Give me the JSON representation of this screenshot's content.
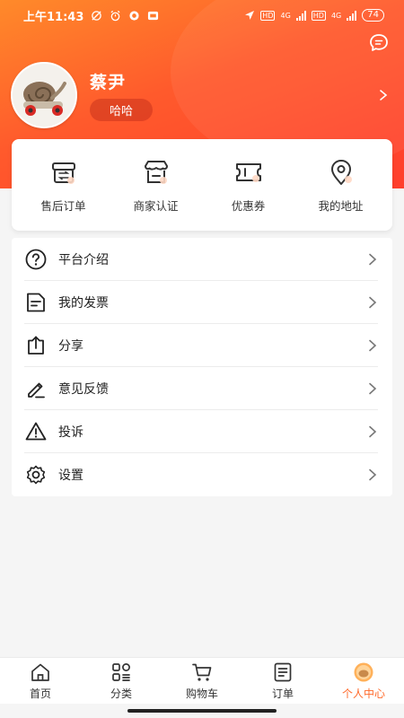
{
  "status": {
    "time": "上午11:43",
    "net_labels": [
      "HD",
      "4G",
      "HD",
      "4G"
    ],
    "battery": "74"
  },
  "profile": {
    "name": "蔡尹",
    "tag": "哈哈"
  },
  "quick_actions": [
    {
      "label": "售后订单",
      "icon": "return-box-icon"
    },
    {
      "label": "商家认证",
      "icon": "store-icon"
    },
    {
      "label": "优惠券",
      "icon": "coupon-icon"
    },
    {
      "label": "我的地址",
      "icon": "location-pin-icon"
    }
  ],
  "menu": [
    {
      "label": "平台介绍",
      "icon": "question-circle-icon"
    },
    {
      "label": "我的发票",
      "icon": "invoice-icon"
    },
    {
      "label": "分享",
      "icon": "share-icon"
    },
    {
      "label": "意见反馈",
      "icon": "pen-icon"
    },
    {
      "label": "投诉",
      "icon": "warning-icon"
    },
    {
      "label": "设置",
      "icon": "gear-icon"
    }
  ],
  "tabs": [
    {
      "label": "首页",
      "icon": "home-icon"
    },
    {
      "label": "分类",
      "icon": "category-icon"
    },
    {
      "label": "购物车",
      "icon": "cart-icon"
    },
    {
      "label": "订单",
      "icon": "order-list-icon"
    },
    {
      "label": "个人中心",
      "icon": "profile-icon",
      "active": true
    }
  ],
  "colors": {
    "accent": "#ff6a2b",
    "header_start": "#ff8a2a",
    "header_end": "#ff3e2c"
  }
}
